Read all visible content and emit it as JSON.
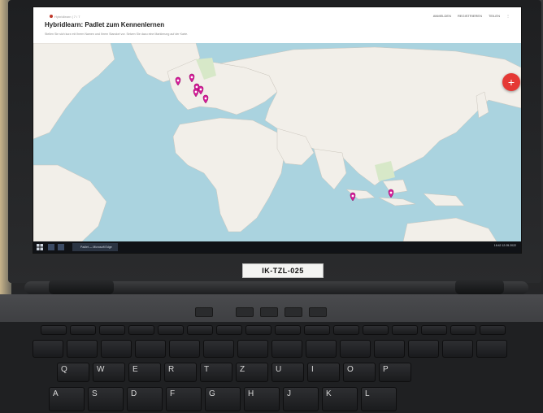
{
  "screen": {
    "breadcrumb": "Hybridlearn | 7 / 7",
    "title": "Hybridlearn: Padlet zum Kennenlernen",
    "subtitle": "Stellen Sie sich kurz mit Ihrem Namen und Ihrem Standort vor. Setzen Sie dazu eine Markierung auf der Karte.",
    "top_menu": [
      "ANMELDEN",
      "REGISTRIEREN",
      "TEILEN",
      "⋮"
    ],
    "fab_label": "+",
    "taskbar_app_label": "Padlet — Microsoft Edge",
    "taskbar_tray": "16:42  12.05.2022"
  },
  "laptop": {
    "asset_tag": "IK-TZL-025"
  },
  "map": {
    "pin_color": "#d81b9a",
    "ocean_color": "#aad3df",
    "land_color": "#f2efe9",
    "pins": [
      {
        "name": "pin-1"
      },
      {
        "name": "pin-2"
      },
      {
        "name": "pin-3"
      },
      {
        "name": "pin-4"
      },
      {
        "name": "pin-5"
      },
      {
        "name": "pin-6"
      },
      {
        "name": "pin-7"
      },
      {
        "name": "pin-8"
      }
    ]
  },
  "keyboard": {
    "row_home": [
      "A",
      "S",
      "D",
      "F",
      "G",
      "H",
      "J",
      "K",
      "L"
    ],
    "row_top": [
      "Q",
      "W",
      "E",
      "R",
      "T",
      "Z",
      "U",
      "I",
      "O",
      "P"
    ]
  }
}
